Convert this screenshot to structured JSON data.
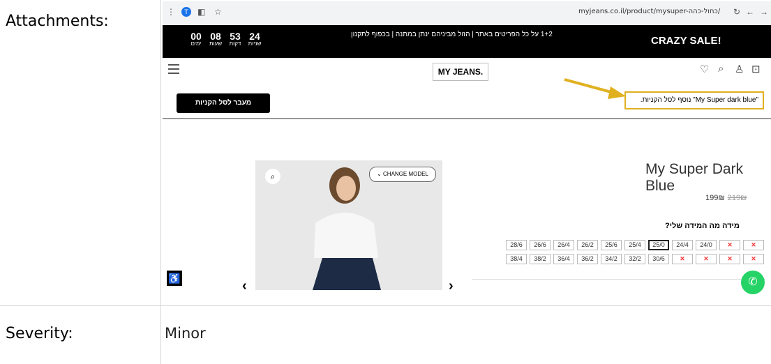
{
  "labels": {
    "attachments": "Attachments:",
    "severity": "Severity:"
  },
  "severity_value": "Minor",
  "browser": {
    "url": "myjeans.co.il/product/mysuper-כחול-כהה/",
    "profile_initial": "T"
  },
  "promo": {
    "countdown": [
      {
        "value": "00",
        "unit": "ימים"
      },
      {
        "value": "08",
        "unit": "שעות"
      },
      {
        "value": "53",
        "unit": "דקות"
      },
      {
        "value": "24",
        "unit": "שניות"
      }
    ],
    "text": "1+2 על כל הפריטים באתר | הזול מביניהם ינתן במתנה | בכפוף לתקנון",
    "sale": "CRAZY SALE!"
  },
  "header": {
    "logo": "MY JEANS.",
    "checkout": "מעבר לסל הקניות",
    "notice": "\"My Super dark blue\" נוסף לסל הקניות."
  },
  "product": {
    "change_model": "CHANGE MODEL",
    "title": "My Super Dark Blue",
    "price": "199₪",
    "old_price": "219₪",
    "size_label": "מידה  מה המידה שלי?",
    "sizes_row1": [
      "28/6",
      "26/6",
      "26/4",
      "26/2",
      "25/6",
      "25/4",
      "25/0",
      "24/4",
      "24/0"
    ],
    "sizes_row2": [
      "38/4",
      "38/2",
      "36/4",
      "36/2",
      "34/2",
      "32/2",
      "30/6"
    ],
    "selected_size": "25/0"
  }
}
